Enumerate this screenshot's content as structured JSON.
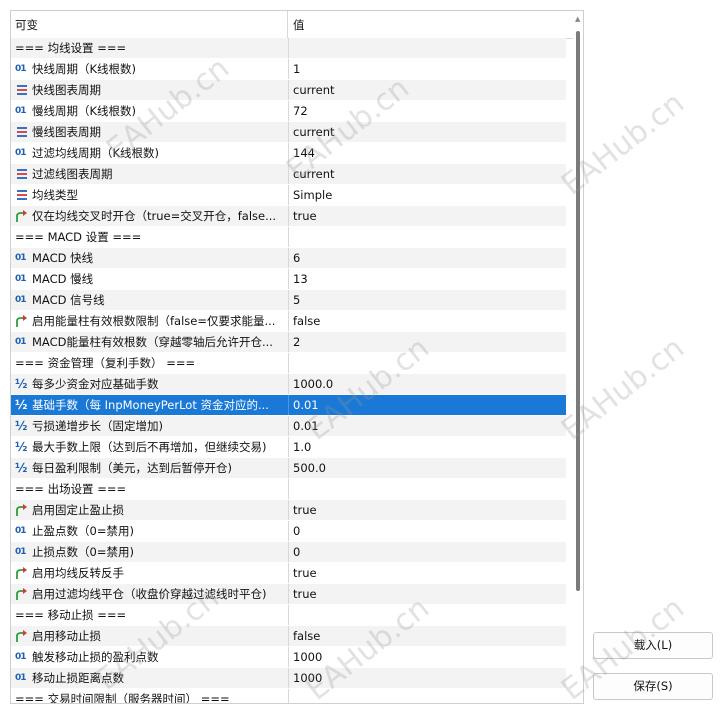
{
  "header": {
    "col_name": "可变",
    "col_value": "值"
  },
  "rows": [
    {
      "icon": "section",
      "name": "=== 均线设置 ===",
      "value": ""
    },
    {
      "icon": "int",
      "name": "快线周期（K线根数)",
      "value": "1"
    },
    {
      "icon": "enum",
      "name": "快线图表周期",
      "value": "current"
    },
    {
      "icon": "int",
      "name": "慢线周期（K线根数)",
      "value": "72"
    },
    {
      "icon": "enum",
      "name": "慢线图表周期",
      "value": "current"
    },
    {
      "icon": "int",
      "name": "过滤均线周期（K线根数)",
      "value": "144"
    },
    {
      "icon": "enum",
      "name": "过滤线图表周期",
      "value": "current"
    },
    {
      "icon": "enum",
      "name": "均线类型",
      "value": "Simple"
    },
    {
      "icon": "bool",
      "name": "仅在均线交叉时开仓（true=交叉开仓，false...",
      "value": "true"
    },
    {
      "icon": "section",
      "name": "=== MACD 设置 ===",
      "value": ""
    },
    {
      "icon": "int",
      "name": "MACD 快线",
      "value": "6"
    },
    {
      "icon": "int",
      "name": "MACD 慢线",
      "value": "13"
    },
    {
      "icon": "int",
      "name": "MACD 信号线",
      "value": "5"
    },
    {
      "icon": "bool",
      "name": "启用能量柱有效根数限制（false=仅要求能量...",
      "value": "false"
    },
    {
      "icon": "int",
      "name": "MACD能量柱有效根数（穿越零轴后允许开仓...",
      "value": "2"
    },
    {
      "icon": "section",
      "name": "=== 资金管理（复利手数） ===",
      "value": ""
    },
    {
      "icon": "frac",
      "name": "每多少资金对应基础手数",
      "value": "1000.0"
    },
    {
      "icon": "frac",
      "name": "基础手数（每 InpMoneyPerLot 资金对应的...",
      "value": "0.01",
      "selected": true
    },
    {
      "icon": "frac",
      "name": "亏损递增步长（固定增加)",
      "value": "0.01"
    },
    {
      "icon": "frac",
      "name": "最大手数上限（达到后不再增加，但继续交易)",
      "value": "1.0"
    },
    {
      "icon": "frac",
      "name": "每日盈利限制（美元，达到后暂停开仓)",
      "value": "500.0"
    },
    {
      "icon": "section",
      "name": "=== 出场设置 ===",
      "value": ""
    },
    {
      "icon": "bool",
      "name": "启用固定止盈止损",
      "value": "true"
    },
    {
      "icon": "int",
      "name": "止盈点数（0=禁用)",
      "value": "0"
    },
    {
      "icon": "int",
      "name": "止损点数（0=禁用)",
      "value": "0"
    },
    {
      "icon": "bool",
      "name": "启用均线反转反手",
      "value": "true"
    },
    {
      "icon": "bool",
      "name": "启用过滤均线平仓（收盘价穿越过滤线时平仓)",
      "value": "true"
    },
    {
      "icon": "section",
      "name": "=== 移动止损 ===",
      "value": ""
    },
    {
      "icon": "bool",
      "name": "启用移动止损",
      "value": "false"
    },
    {
      "icon": "int",
      "name": "触发移动止损的盈利点数",
      "value": "1000"
    },
    {
      "icon": "int",
      "name": "移动止损距离点数",
      "value": "1000"
    },
    {
      "icon": "section",
      "name": "=== 交易时间限制（服务器时间） ===",
      "value": ""
    }
  ],
  "icons": {
    "int": "01",
    "frac": "½"
  },
  "buttons": {
    "load": "载入(L)",
    "save": "保存(S)"
  },
  "watermark": "EAHub.cn",
  "colors": {
    "selected": "#1a79d6",
    "int_icon": "#1f5fb3",
    "bool_arrow": "#2e9e3e",
    "bool_flag": "#d23a3a"
  }
}
